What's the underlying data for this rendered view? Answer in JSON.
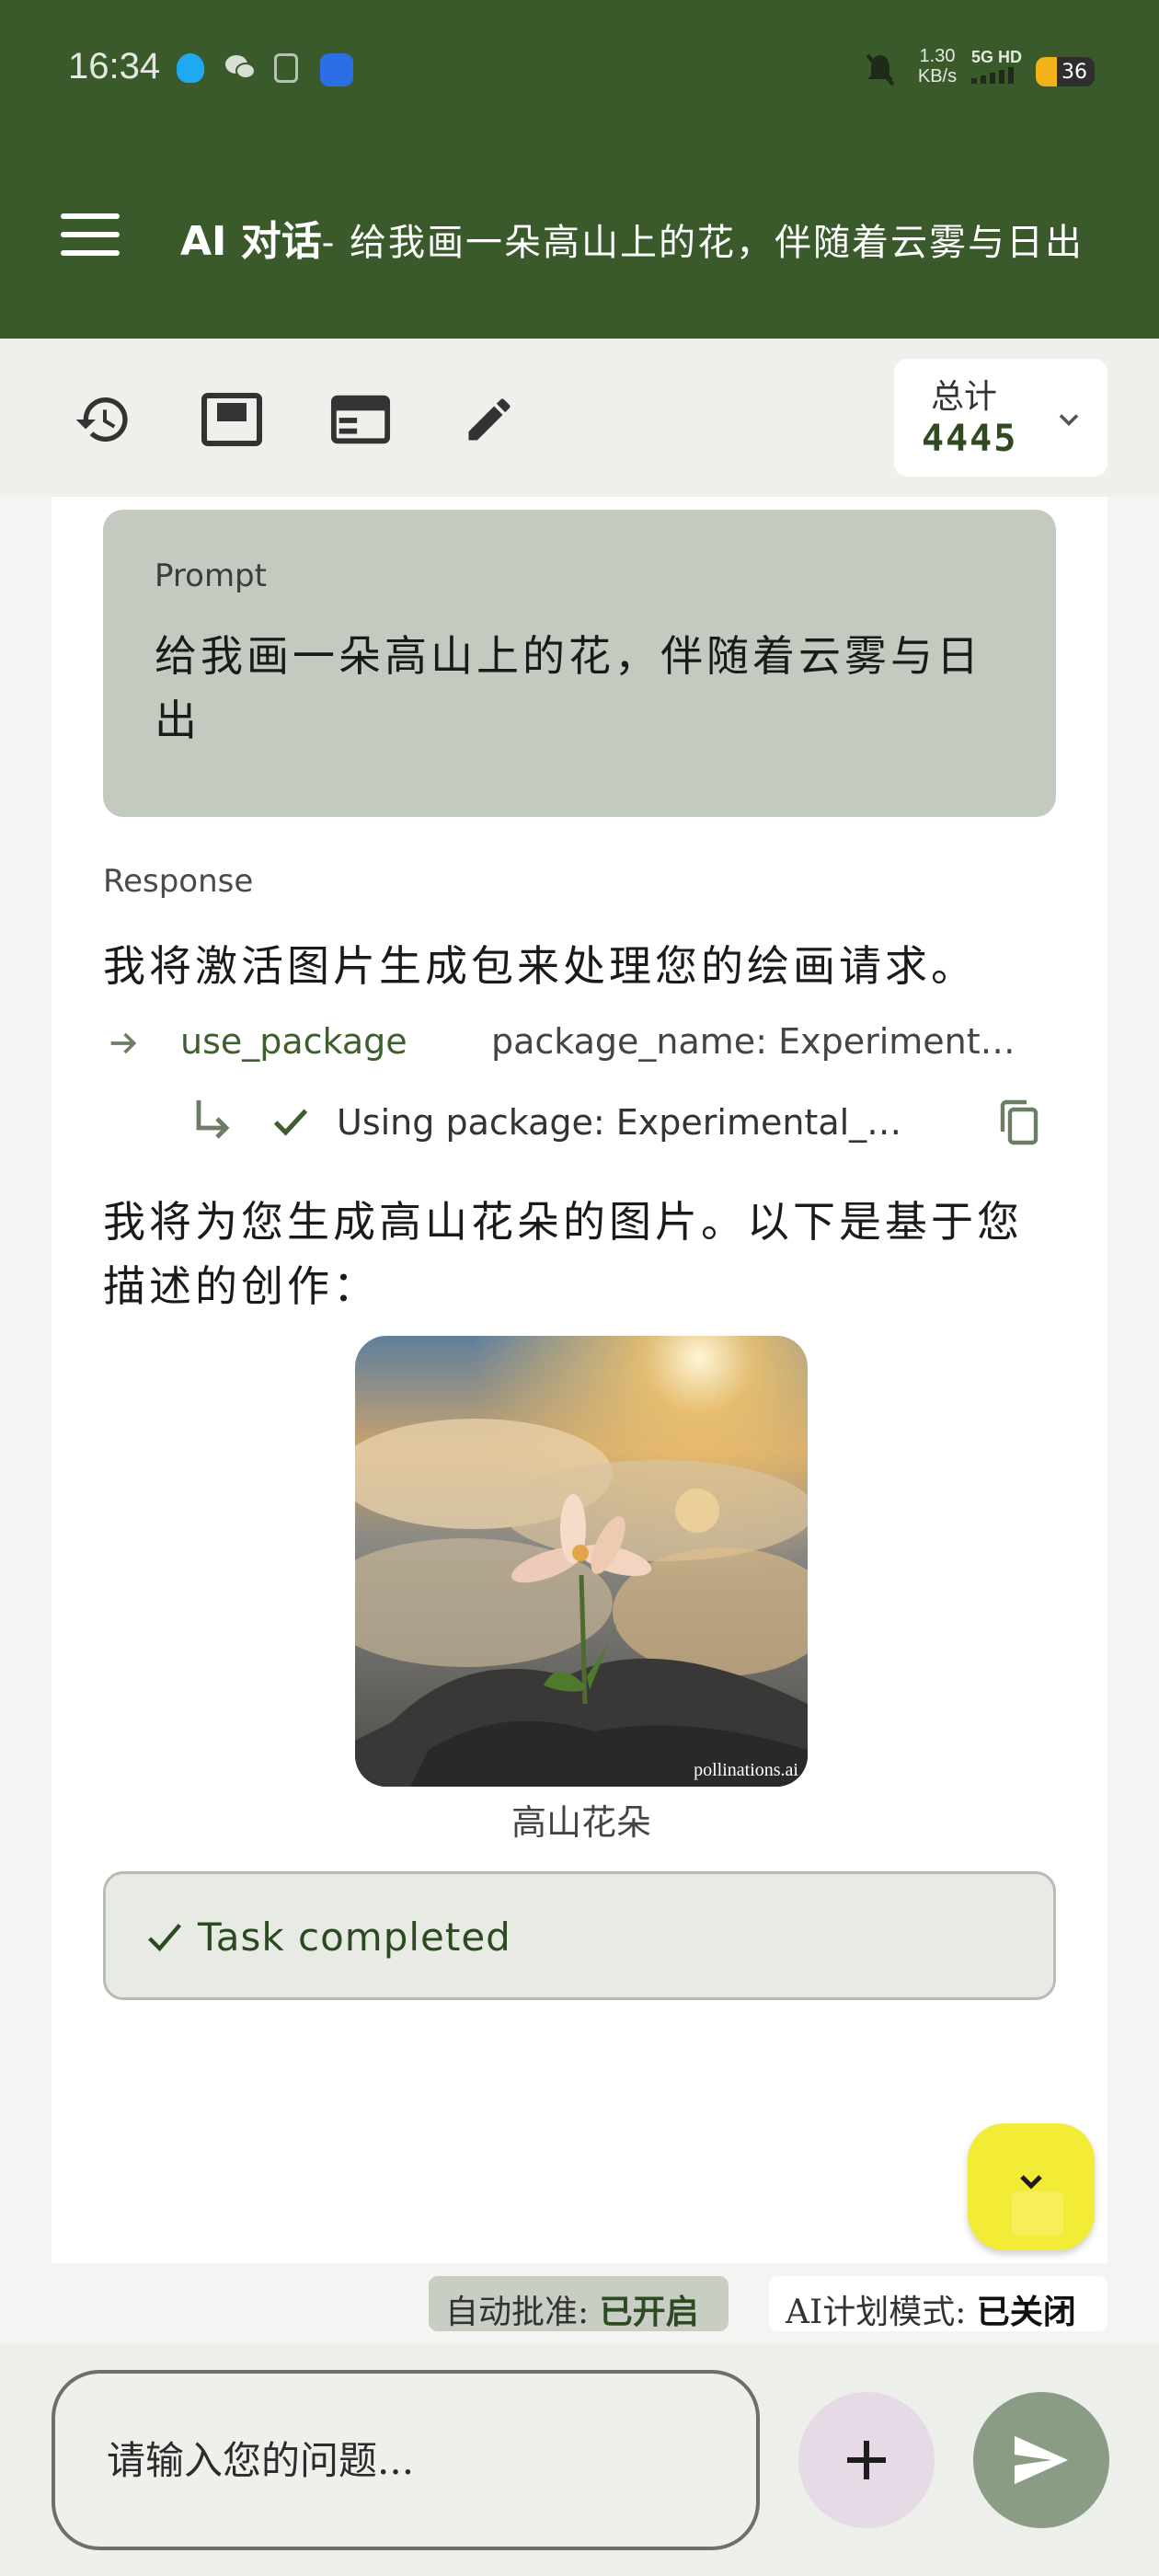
{
  "status_bar": {
    "time": "16:34",
    "network_speed_value": "1.30",
    "network_speed_unit": "KB/s",
    "network_label": "5G HD",
    "battery_level": 36,
    "battery_text": "36"
  },
  "app_bar": {
    "title": "AI 对话",
    "subtitle": "- 给我画一朵高山上的花，伴随着云雾与日出"
  },
  "toolbar": {
    "icons": [
      "history-icon",
      "picture-in-picture-icon",
      "web-layout-icon",
      "edit-pencil-icon"
    ],
    "total_label": "总计",
    "total_value": "4445"
  },
  "conversation": {
    "prompt_label": "Prompt",
    "prompt_text": "给我画一朵高山上的花，伴随着云雾与日出",
    "response_label": "Response",
    "response_intro": "我将激活图片生成包来处理您的绘画请求。",
    "tool_call": {
      "name": "use_package",
      "params": "package_name: Experimental_Image_Generation"
    },
    "tool_result": {
      "text": "Using package: Experimental_Image_Generation"
    },
    "response_body_line1": "我将为您生成高山花朵的图片。以下是基于您",
    "response_body_line2": "描述的创作：",
    "image_caption": "高山花朵",
    "image_watermark": "pollinations.ai",
    "task_status": "Task completed"
  },
  "modes": {
    "auto_approve_label": "自动批准: ",
    "auto_approve_value": "已开启",
    "plan_mode_label": "AI计划模式: ",
    "plan_mode_value": "已关闭"
  },
  "input": {
    "placeholder": "请输入您的问题..."
  },
  "colors": {
    "app_bar": "#3b5a2c",
    "accent_green": "#3f5e30",
    "prompt_card": "#c3cabf",
    "scroll_fab": "#f3ec37",
    "send_button": "#8b9c85",
    "add_button": "#e6dae6"
  }
}
